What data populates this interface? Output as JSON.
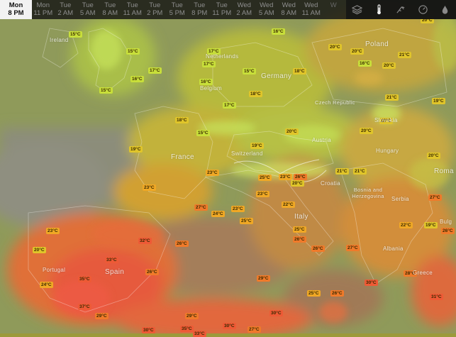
{
  "timeline": {
    "slots": [
      {
        "day": "Mon",
        "time": "8 PM",
        "selected": true
      },
      {
        "day": "Mon",
        "time": "11 PM",
        "selected": false
      },
      {
        "day": "Tue",
        "time": "2 AM",
        "selected": false
      },
      {
        "day": "Tue",
        "time": "5 AM",
        "selected": false
      },
      {
        "day": "Tue",
        "time": "8 AM",
        "selected": false
      },
      {
        "day": "Tue",
        "time": "11 AM",
        "selected": false
      },
      {
        "day": "Tue",
        "time": "2 PM",
        "selected": false
      },
      {
        "day": "Tue",
        "time": "5 PM",
        "selected": false
      },
      {
        "day": "Tue",
        "time": "8 PM",
        "selected": false
      },
      {
        "day": "Tue",
        "time": "11 PM",
        "selected": false
      },
      {
        "day": "Wed",
        "time": "2 AM",
        "selected": false
      },
      {
        "day": "Wed",
        "time": "5 AM",
        "selected": false
      },
      {
        "day": "Wed",
        "time": "8 AM",
        "selected": false
      },
      {
        "day": "Wed",
        "time": "11 AM",
        "selected": false
      },
      {
        "day": "W",
        "time": "",
        "selected": false
      }
    ]
  },
  "toolbar": {
    "icons": [
      "layers-icon",
      "thermometer-icon",
      "wind-icon",
      "pressure-gauge-icon",
      "precipitation-drop-icon"
    ]
  },
  "colors": {
    "cool": "#c8df3a",
    "mild": "#e0c52a",
    "warm": "#f0a825",
    "hot": "#f07a2a",
    "veryhot": "#ee5a36"
  },
  "countries": [
    "Ireland",
    "Netherlands",
    "Belgium",
    "Germany",
    "Poland",
    "Czech Republic",
    "Slovakia",
    "Austria",
    "Switzerland",
    "Hungary",
    "France",
    "Croatia",
    "Bosnia and Herzegovina",
    "Serbia",
    "Italy",
    "Roma",
    "Portugal",
    "Spain",
    "Albania",
    "Greece",
    "Bulg"
  ],
  "temperatures": [
    "15°C",
    "15°C",
    "15°C",
    "16°C",
    "17°C",
    "17°C",
    "17°C",
    "16°C",
    "15°C",
    "17°C",
    "18°C",
    "16°C",
    "20°C",
    "20°C",
    "21°C",
    "20°C",
    "20°C",
    "19°C",
    "18°C",
    "21°C",
    "16°C",
    "20°C",
    "20°C",
    "18°C",
    "15°C",
    "19°C",
    "19°C",
    "20°C",
    "21°C",
    "23°C",
    "20°C",
    "25°C",
    "23°C",
    "26°C",
    "23°C",
    "23°C",
    "27°C",
    "23°C",
    "22°C",
    "21°C",
    "27°C",
    "24°C",
    "25°C",
    "20°C",
    "22°C",
    "19°C",
    "26°C",
    "23°C",
    "32°C",
    "26°C",
    "20°C",
    "33°C",
    "26°C",
    "25°C",
    "26°C",
    "27°C",
    "35°C",
    "26°C",
    "28°C",
    "29°C",
    "24°C",
    "30°C",
    "31°C",
    "37°C",
    "29°C",
    "29°C",
    "25°C",
    "26°C",
    "30°C",
    "30°C",
    "35°C",
    "27°C",
    "30°C",
    "33°C"
  ]
}
